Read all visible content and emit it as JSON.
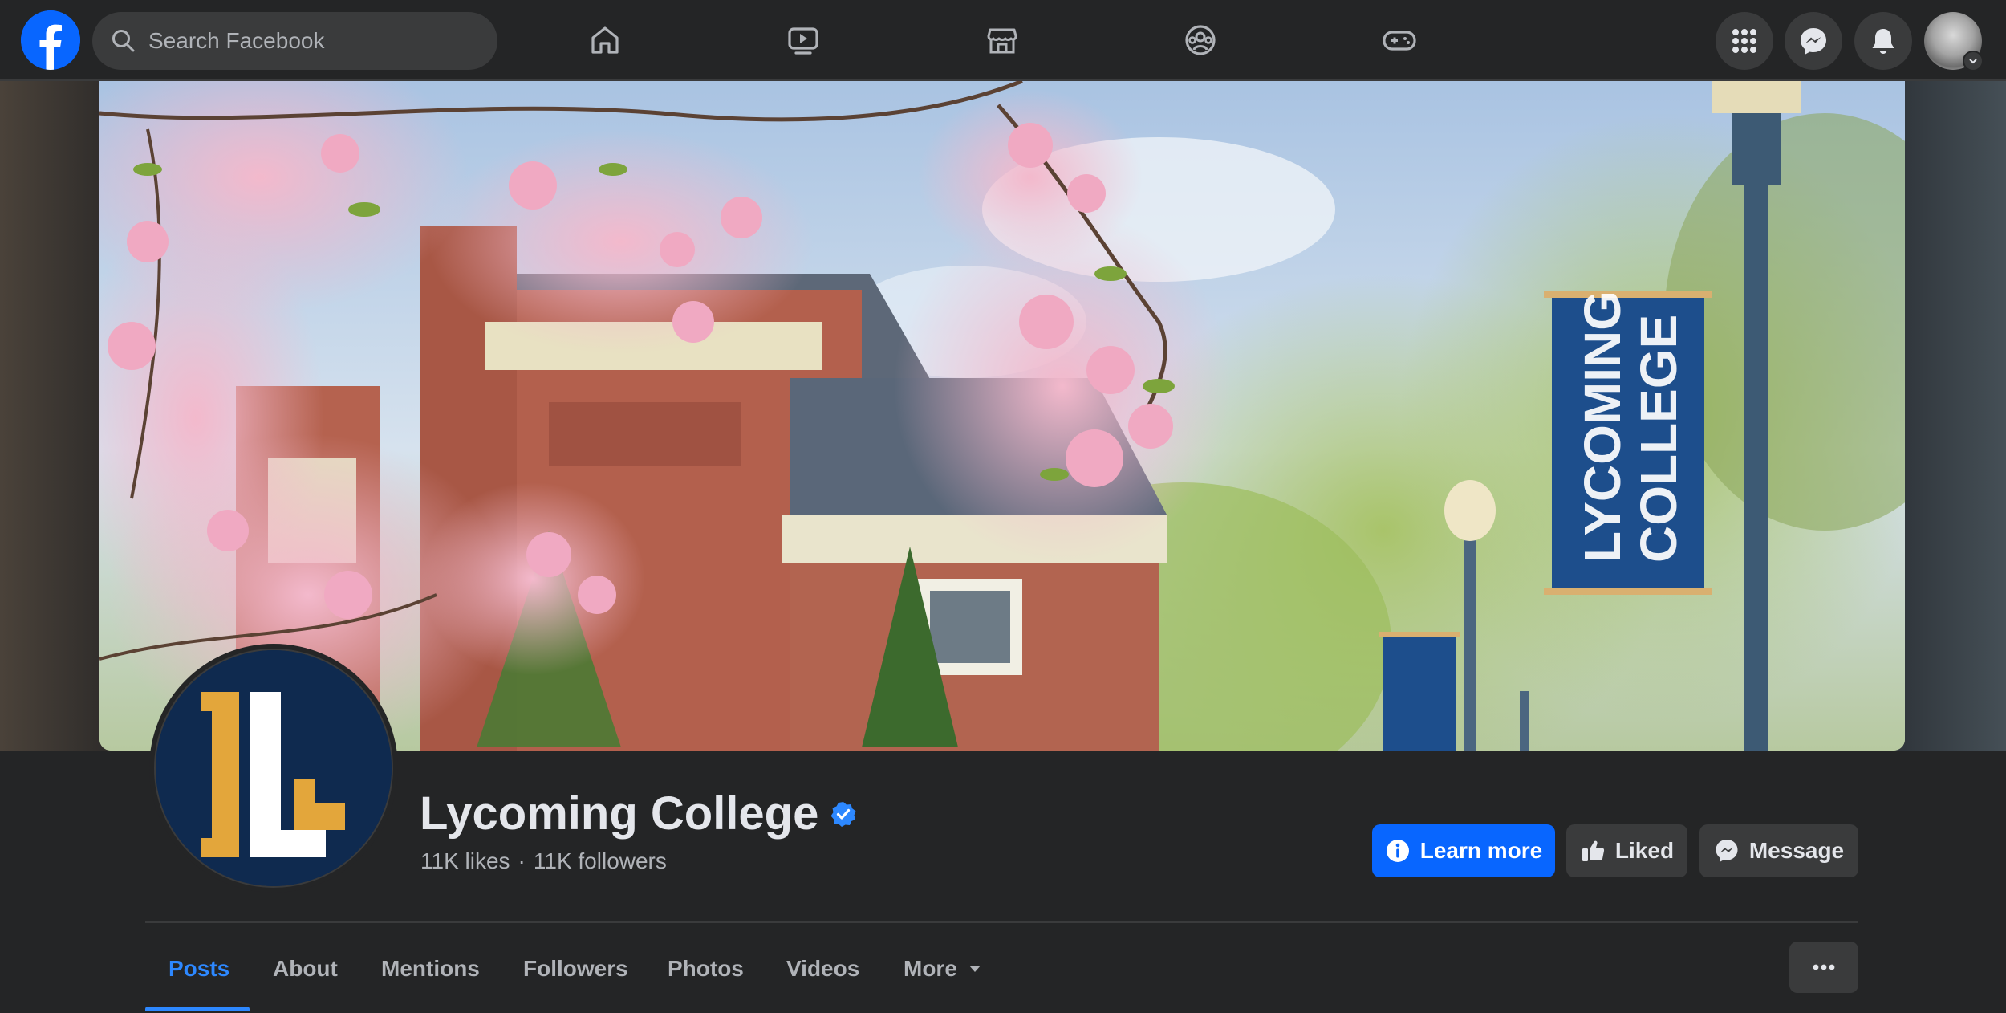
{
  "nav": {
    "search_placeholder": "Search Facebook",
    "icons": [
      "facebook-logo",
      "home-icon",
      "watch-icon",
      "marketplace-icon",
      "groups-icon",
      "gaming-icon",
      "menu-grid-icon",
      "messenger-icon",
      "notifications-icon",
      "account-avatar"
    ]
  },
  "cover": {
    "banner_text_line1": "LYCOMING",
    "banner_text_line2": "COLLEGE"
  },
  "page": {
    "name": "Lycoming College",
    "verified": true,
    "likes": "11K likes",
    "followers": "11K followers",
    "separator": "·"
  },
  "actions": {
    "learn_more": "Learn more",
    "liked": "Liked",
    "message": "Message"
  },
  "tabs": [
    {
      "label": "Posts",
      "active": true
    },
    {
      "label": "About",
      "active": false
    },
    {
      "label": "Mentions",
      "active": false
    },
    {
      "label": "Followers",
      "active": false
    },
    {
      "label": "Photos",
      "active": false
    },
    {
      "label": "Videos",
      "active": false
    },
    {
      "label": "More",
      "active": false
    }
  ],
  "colors": {
    "background": "#242526",
    "surface": "#3a3b3c",
    "accent": "#0866ff",
    "active_tab": "#2d88ff",
    "text_primary": "#e4e6eb",
    "text_secondary": "#b0b3b8",
    "logo_navy": "#0f2a4f",
    "logo_gold": "#e3a63b"
  }
}
